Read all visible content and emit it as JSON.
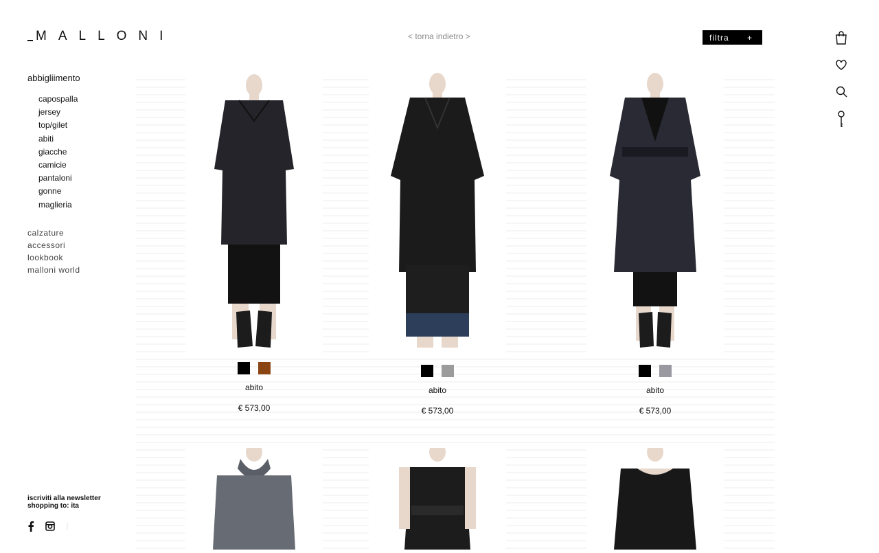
{
  "brand": {
    "name": "MALLONI"
  },
  "header": {
    "back_link": "< torna indietro >",
    "filter_label": "filtra",
    "filter_icon": "+"
  },
  "icons": [
    "bag-icon",
    "heart-icon",
    "search-icon",
    "key-icon"
  ],
  "sidebar": {
    "category_title": "abbigliimento",
    "subcategories": [
      "capospalla",
      "jersey",
      "top/gilet",
      "abiti",
      "giacche",
      "camicie",
      "pantaloni",
      "gonne",
      "maglieria"
    ],
    "main_categories": [
      "calzature",
      "accessori",
      "lookbook",
      "malloni world"
    ]
  },
  "footer": {
    "newsletter": "iscriviti alla newsletter",
    "shopping_to": "shopping to: ita"
  },
  "products": [
    {
      "name": "abito",
      "price": "€ 573,00",
      "swatches": [
        "#000000",
        "#8b4513"
      ]
    },
    {
      "name": "abito",
      "price": "€ 573,00",
      "swatches": [
        "#000000",
        "#9b9b9b"
      ]
    },
    {
      "name": "abito",
      "price": "€ 573,00",
      "swatches": [
        "#000000",
        "#9a98a0"
      ]
    },
    {
      "name": "",
      "price": "",
      "swatches": []
    },
    {
      "name": "",
      "price": "",
      "swatches": []
    },
    {
      "name": "",
      "price": "",
      "swatches": []
    }
  ]
}
